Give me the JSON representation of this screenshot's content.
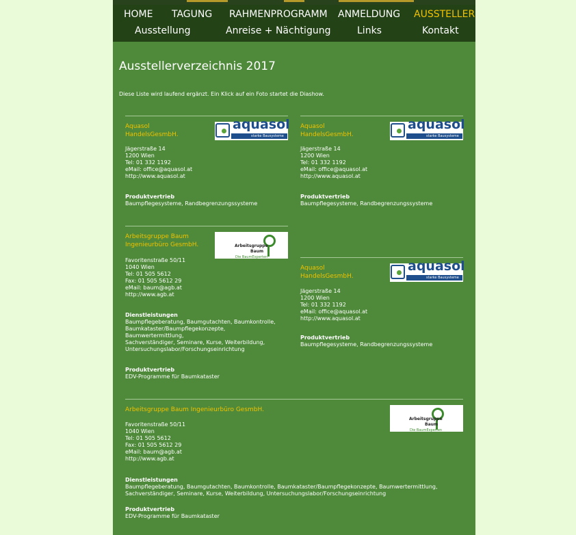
{
  "nav": {
    "row1": [
      "HOME",
      "TAGUNG",
      "RAHMENPROGRAMM",
      "ANMELDUNG",
      "AUSSTELLER"
    ],
    "row2": [
      "Ausstellung",
      "Anreise + Nächtigung",
      "Links",
      "Kontakt"
    ],
    "active": "AUSSTELLER"
  },
  "page_title": "Ausstellerverzeichnis 2017",
  "intro": "Diese Liste wird laufend ergänzt. Ein Klick auf ein Foto startet die Diashow.",
  "logos": {
    "aquasol": {
      "word": "aquasol",
      "tagline": "starke Bausysteme"
    },
    "agb": {
      "line1": "Arbeitsgruppe",
      "line2": "Baum",
      "line3": "Die BaumExperten"
    }
  },
  "entries": [
    {
      "name_lines": [
        "Aquasol",
        "HandelsGesmbH."
      ],
      "address": [
        "Jägerstraße 14",
        "1200 Wien",
        "Tel: 01 332 1192",
        "eMail: office@aquasol.at",
        "http://www.aquasol.at"
      ],
      "sections": [
        {
          "heading": "Produktvertrieb",
          "lines": [
            "Baumpflegesysteme, Randbegrenzungssysteme"
          ]
        }
      ]
    },
    {
      "name_lines": [
        "Aquasol",
        "HandelsGesmbH."
      ],
      "address": [
        "Jägerstraße 14",
        "1200 Wien",
        "Tel: 01 332 1192",
        "eMail: office@aquasol.at",
        "http://www.aquasol.at"
      ],
      "sections": [
        {
          "heading": "Produktvertrieb",
          "lines": [
            "Baumpflegesysteme, Randbegrenzungssysteme"
          ]
        }
      ]
    },
    {
      "name_lines": [
        "Arbeitsgruppe Baum",
        "Ingenieurbüro GesmbH."
      ],
      "address": [
        "Favoritenstraße 50/11",
        "1040 Wien",
        "Tel: 01 505 5612",
        "Fax: 01 505 5612 29",
        "eMail: baum@agb.at",
        "http://www.agb.at"
      ],
      "sections": [
        {
          "heading": "Dienstleistungen",
          "lines": [
            "Baumpflegeberatung, Baumgutachten, Baumkontrolle,",
            "Baumkataster/Baumpflegekonzepte,",
            "Baumwertermittlung,",
            "Sachverständiger, Seminare, Kurse, Weiterbildung,",
            "Untersuchungslabor/Forschungseinrichtung"
          ]
        },
        {
          "heading": "Produktvertrieb",
          "lines": [
            "EDV-Programme für Baumkataster"
          ]
        }
      ]
    },
    {
      "name_lines": [
        "Aquasol",
        "HandelsGesmbH."
      ],
      "address": [
        "Jägerstraße 14",
        "1200 Wien",
        "Tel: 01 332 1192",
        "eMail: office@aquasol.at",
        "http://www.aquasol.at"
      ],
      "sections": [
        {
          "heading": "Produktvertrieb",
          "lines": [
            "Baumpflegesysteme, Randbegrenzungssysteme"
          ]
        }
      ]
    },
    {
      "name_lines": [
        "Arbeitsgruppe Baum Ingenieurbüro GesmbH."
      ],
      "address": [
        "Favoritenstraße 50/11",
        "1040 Wien",
        "Tel: 01 505 5612",
        "Fax: 01 505 5612 29",
        "eMail: baum@agb.at",
        "http://www.agb.at"
      ],
      "sections": [
        {
          "heading": "Dienstleistungen",
          "lines": [
            "Baumpflegeberatung, Baumgutachten, Baumkontrolle, Baumkataster/Baumpflegekonzepte, Baumwertermittlung,",
            "Sachverständiger, Seminare, Kurse, Weiterbildung, Untersuchungslabor/Forschungseinrichtung"
          ]
        },
        {
          "heading": "Produktvertrieb",
          "lines": [
            "EDV-Programme für Baumkataster"
          ]
        }
      ]
    }
  ]
}
